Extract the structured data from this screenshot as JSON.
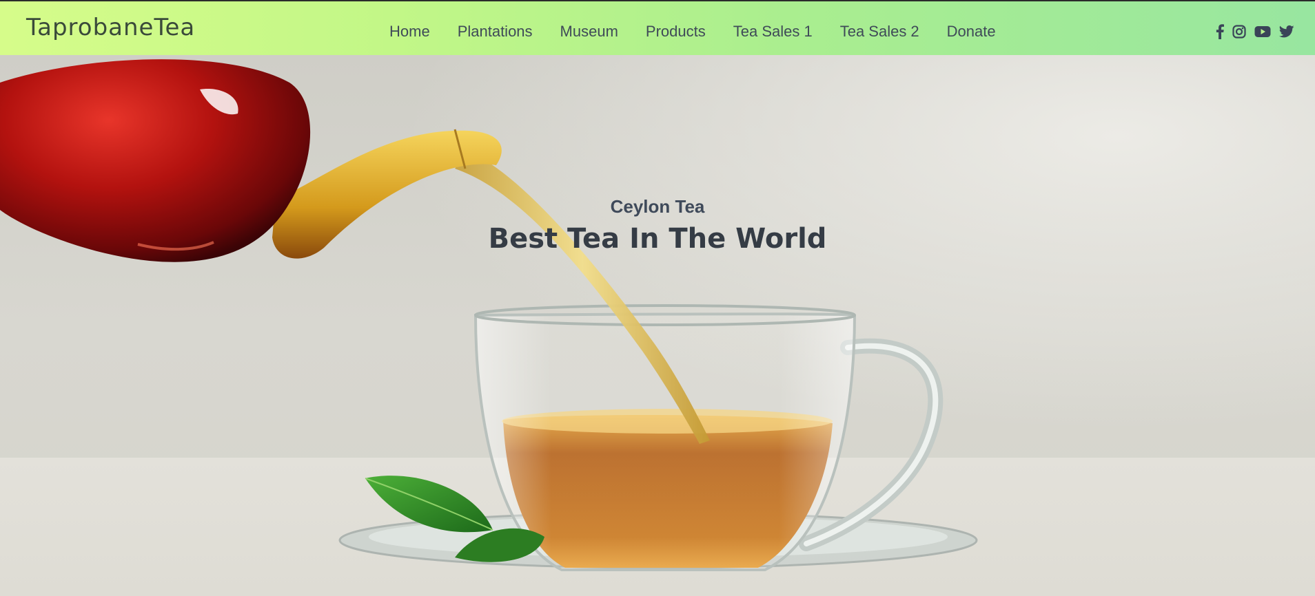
{
  "header": {
    "brand": "TaprobaneTea",
    "nav": [
      {
        "label": "Home"
      },
      {
        "label": "Plantations"
      },
      {
        "label": "Museum"
      },
      {
        "label": "Products"
      },
      {
        "label": "Tea Sales 1"
      },
      {
        "label": "Tea Sales 2"
      },
      {
        "label": "Donate"
      }
    ],
    "social_icons": [
      "facebook-icon",
      "instagram-icon",
      "youtube-icon",
      "twitter-icon"
    ]
  },
  "hero": {
    "subtitle": "Ceylon Tea",
    "title": "Best Tea In The World"
  },
  "colors": {
    "nav_gradient_start": "#d6fc8a",
    "nav_gradient_end": "#98e6a0",
    "heading_text": "#353c45",
    "tea": "#b5621a"
  }
}
